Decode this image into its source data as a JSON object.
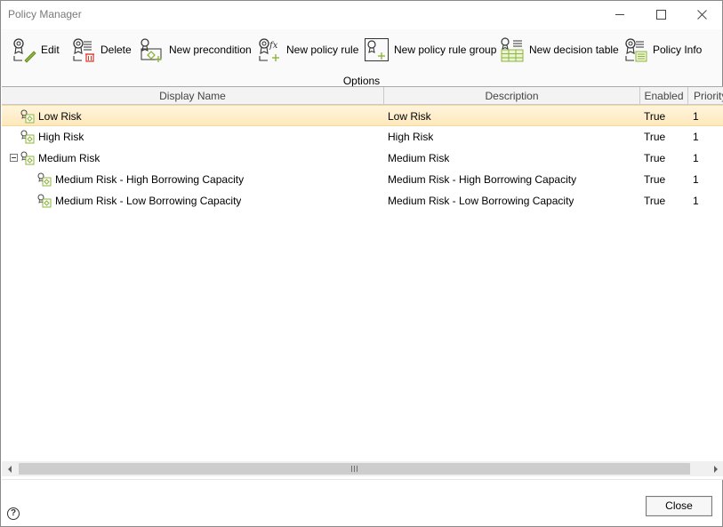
{
  "window": {
    "title": "Policy Manager"
  },
  "toolbar": {
    "items": [
      {
        "label": "Edit",
        "icon": "edit-icon"
      },
      {
        "label": "Delete",
        "icon": "delete-icon"
      },
      {
        "label": "New precondition",
        "icon": "new-precondition-icon"
      },
      {
        "label": "New policy rule",
        "icon": "new-policy-rule-icon"
      },
      {
        "label": "New policy rule group",
        "icon": "new-policy-rule-group-icon"
      },
      {
        "label": "New decision table",
        "icon": "new-decision-table-icon"
      },
      {
        "label": "Policy Info",
        "icon": "policy-info-icon"
      }
    ],
    "group_label": "Options"
  },
  "grid": {
    "columns": [
      "Display Name",
      "Description",
      "Enabled",
      "Priority"
    ],
    "rows": [
      {
        "name": "Low Risk",
        "description": "Low Risk",
        "enabled": "True",
        "priority": "1",
        "selected": true
      },
      {
        "name": "High Risk",
        "description": "High Risk",
        "enabled": "True",
        "priority": "1"
      },
      {
        "name": "Medium Risk",
        "description": "Medium Risk",
        "enabled": "True",
        "priority": "1",
        "expanded": true
      },
      {
        "name": "Medium Risk - High Borrowing Capacity",
        "description": "Medium Risk - High Borrowing Capacity",
        "enabled": "True",
        "priority": "1"
      },
      {
        "name": "Medium Risk - Low Borrowing Capacity",
        "description": "Medium Risk - Low Borrowing Capacity",
        "enabled": "True",
        "priority": "1"
      }
    ]
  },
  "footer": {
    "close_label": "Close",
    "help_label": "?"
  },
  "colors": {
    "selection": "#ffe9bd",
    "accent": "#8db53a",
    "delete": "#d9362b"
  }
}
